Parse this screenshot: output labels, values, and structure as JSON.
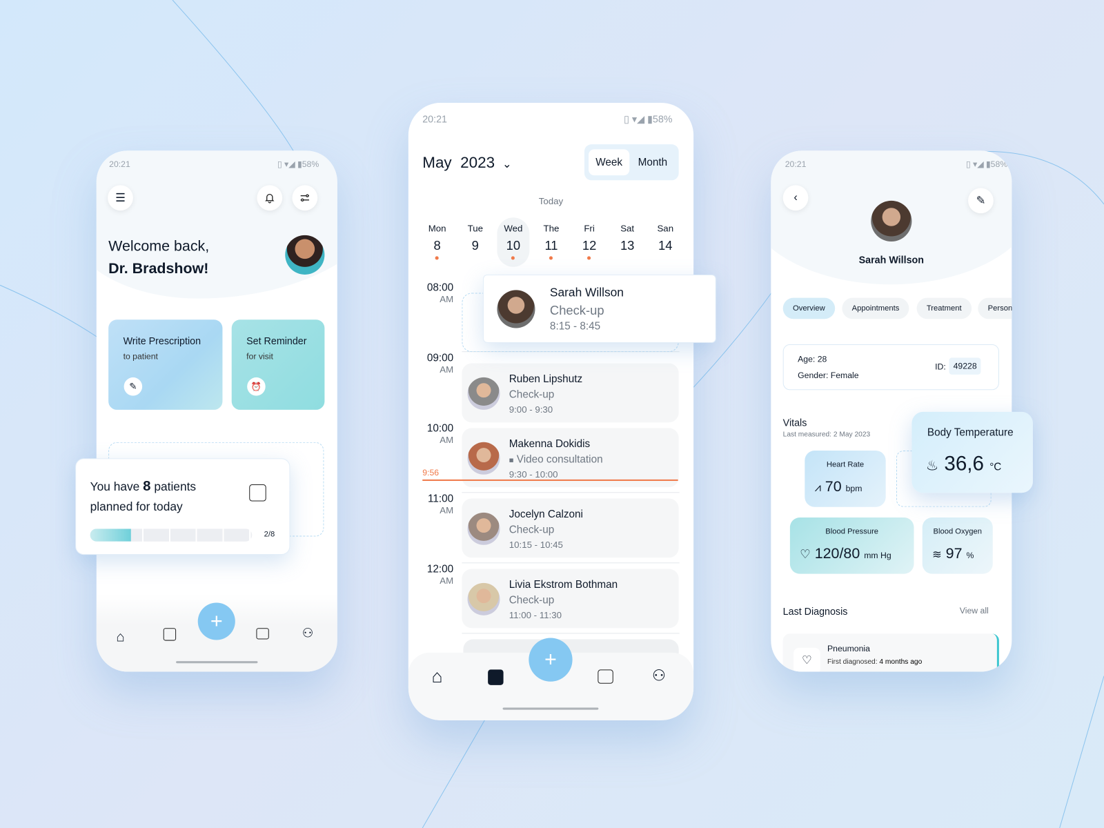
{
  "status": {
    "time": "20:21",
    "battery": "58%"
  },
  "home": {
    "welcome_line1": "Welcome back,",
    "welcome_line2": "Dr. Bradshow!",
    "actions": [
      {
        "title": "Write Prescription",
        "subtitle": "to patient",
        "icon": "pen-icon"
      },
      {
        "title": "Set Reminder",
        "subtitle": "for visit",
        "icon": "alarm-icon"
      }
    ],
    "patients_pre": "You have",
    "patients_count": "8",
    "patients_post": "patients",
    "patients_line2": "planned for today",
    "progress": "2/8",
    "progress_fraction": 0.25
  },
  "calendar": {
    "month": "May",
    "year": "2023",
    "toggle": [
      "Week",
      "Month"
    ],
    "today_label": "Today",
    "days": [
      {
        "d": "Mon",
        "n": "8",
        "dot": true
      },
      {
        "d": "Tue",
        "n": "9",
        "dot": false
      },
      {
        "d": "Wed",
        "n": "10",
        "dot": true,
        "selected": true
      },
      {
        "d": "The",
        "n": "11",
        "dot": true
      },
      {
        "d": "Fri",
        "n": "12",
        "dot": true
      },
      {
        "d": "Sat",
        "n": "13",
        "dot": false
      },
      {
        "d": "San",
        "n": "14",
        "dot": false
      }
    ],
    "hours": [
      {
        "t": "08:00",
        "p": "AM"
      },
      {
        "t": "09:00",
        "p": "AM"
      },
      {
        "t": "10:00",
        "p": "AM"
      },
      {
        "t": "11:00",
        "p": "AM"
      },
      {
        "t": "12:00",
        "p": "AM"
      }
    ],
    "now": "9:56",
    "featured": {
      "name": "Sarah Willson",
      "type": "Check-up",
      "time": "8:15 - 8:45"
    },
    "appointments": [
      {
        "name": "Ruben Lipshutz",
        "type": "Check-up",
        "time": "9:00 - 9:30"
      },
      {
        "name": "Makenna Dokidis",
        "type": "Video consultation",
        "time": "9:30 - 10:00"
      },
      {
        "name": "Jocelyn Calzoni",
        "type": "Check-up",
        "time": "10:15 - 10:45"
      },
      {
        "name": "Livia Ekstrom Bothman",
        "type": "Check-up",
        "time": "11:00 - 11:30"
      }
    ]
  },
  "patient": {
    "name": "Sarah Willson",
    "tabs": [
      "Overview",
      "Appointments",
      "Treatment",
      "Personal"
    ],
    "age": "Age: 28",
    "gender": "Gender: Female",
    "id_label": "ID:",
    "id": "49228",
    "vitals_title": "Vitals",
    "vitals_sub": "Last measured: 2 May 2023",
    "heart": {
      "label": "Heart Rate",
      "value": "70",
      "unit": "bpm"
    },
    "temp": {
      "label": "Body Temperature",
      "value": "36,6",
      "unit": "°C"
    },
    "bp": {
      "label": "Blood Pressure",
      "value": "120/80",
      "unit": "mm Hg"
    },
    "ox": {
      "label": "Blood Oxygen",
      "value": "97",
      "unit": "%"
    },
    "diag_title": "Last Diagnosis",
    "view_all": "View all",
    "diag_name": "Pneumonia",
    "diag_sub_pre": "First diagnosed:",
    "diag_sub": "4 months ago"
  },
  "colors": {
    "accent": "#85c8f2",
    "teal": "#8fdde0",
    "now_line": "#f07a4a"
  }
}
